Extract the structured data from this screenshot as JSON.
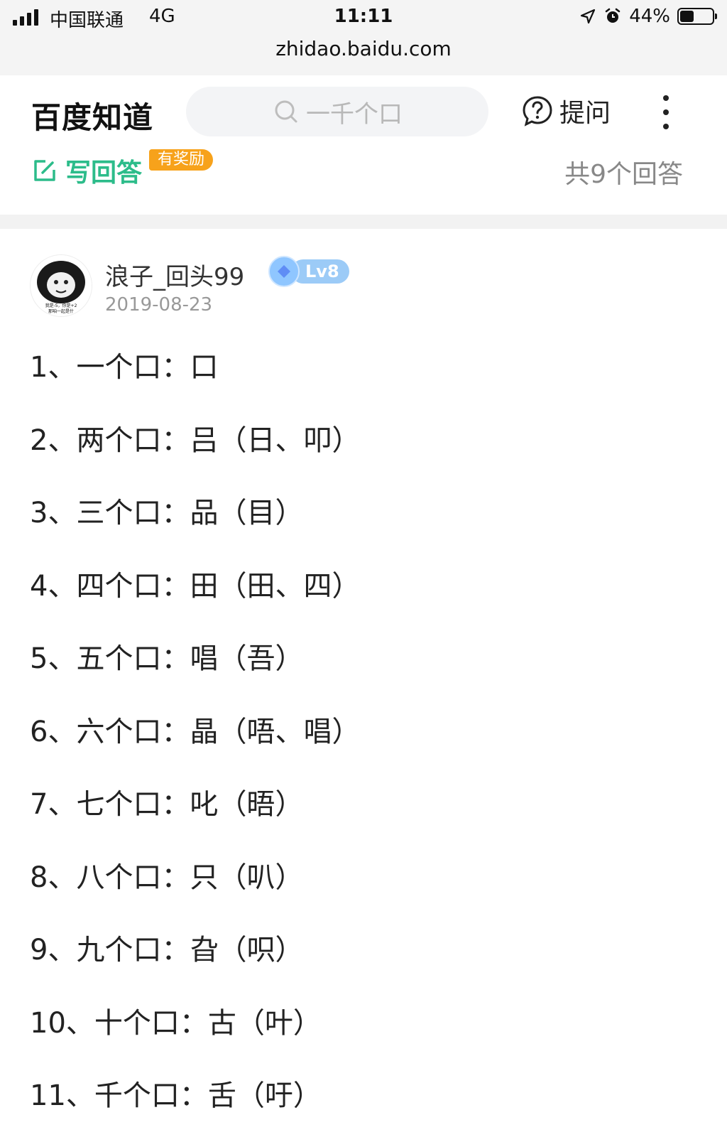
{
  "status_bar": {
    "carrier": "中国联通",
    "network": "4G",
    "time": "11:11",
    "battery": "44%",
    "battery_level": 0.44
  },
  "browser": {
    "url": "zhidao.baidu.com"
  },
  "header": {
    "logo": "百度知道",
    "search_placeholder": "一千个口",
    "ask_label": "提问"
  },
  "answer_bar": {
    "write_answer": "写回答",
    "reward_badge": "有奖励",
    "answer_count": "共9个回答"
  },
  "answer": {
    "username": "浪子_回头99",
    "level": "Lv8",
    "date": "2019-08-23",
    "avatar_caption_top": "我是-5，你是+2",
    "avatar_caption_bottom": "那咱一起是什",
    "lines": [
      "1、一个口：口",
      "2、两个口：吕（日、叩）",
      "3、三个口：品（目）",
      "4、四个口：田（田、四）",
      "5、五个口：唱（吾）",
      "6、六个口：晶（唔、唱）",
      "7、七个口：叱（晤）",
      "8、八个口：只（叭）",
      "9、九个口：旮（呮）",
      "10、十个口：古（叶）",
      "11、千个口：舌（吁）"
    ]
  },
  "colors": {
    "accent_green": "#2cbc8a",
    "reward_orange": "#f7a21b",
    "level_blue": "#9ccbf7"
  }
}
